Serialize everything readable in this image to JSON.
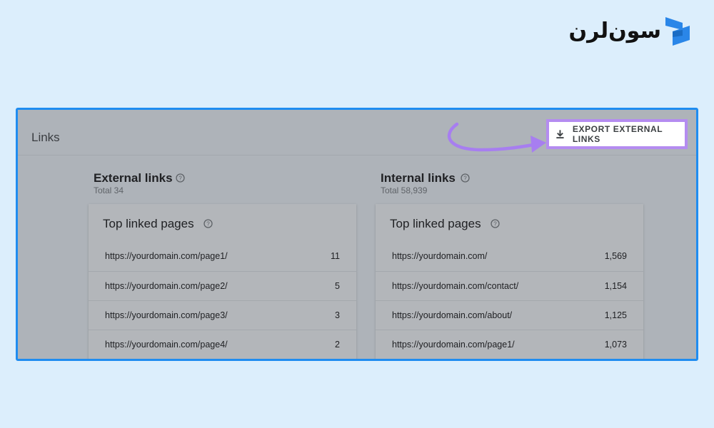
{
  "brand": {
    "logo_text": "سون‌لرن",
    "colors": {
      "mark": "#2a86e8"
    }
  },
  "panel": {
    "title": "Links",
    "export_button": {
      "label": "EXPORT EXTERNAL LINKS",
      "icon": "download-icon"
    },
    "highlight_color": "#b48cf0",
    "arrow_color": "#a77ef0"
  },
  "external": {
    "title": "External links",
    "total": "Total 34",
    "card_title": "Top linked pages",
    "rows": [
      {
        "url": "https://yourdomain.com/page1/",
        "count": "11"
      },
      {
        "url": "https://yourdomain.com/page2/",
        "count": "5"
      },
      {
        "url": "https://yourdomain.com/page3/",
        "count": "3"
      },
      {
        "url": "https://yourdomain.com/page4/",
        "count": "2"
      }
    ]
  },
  "internal": {
    "title": "Internal links",
    "total": "Total 58,939",
    "card_title": "Top linked pages",
    "rows": [
      {
        "url": "https://yourdomain.com/",
        "count": "1,569"
      },
      {
        "url": "https://yourdomain.com/contact/",
        "count": "1,154"
      },
      {
        "url": "https://yourdomain.com/about/",
        "count": "1,125"
      },
      {
        "url": "https://yourdomain.com/page1/",
        "count": "1,073"
      }
    ]
  }
}
